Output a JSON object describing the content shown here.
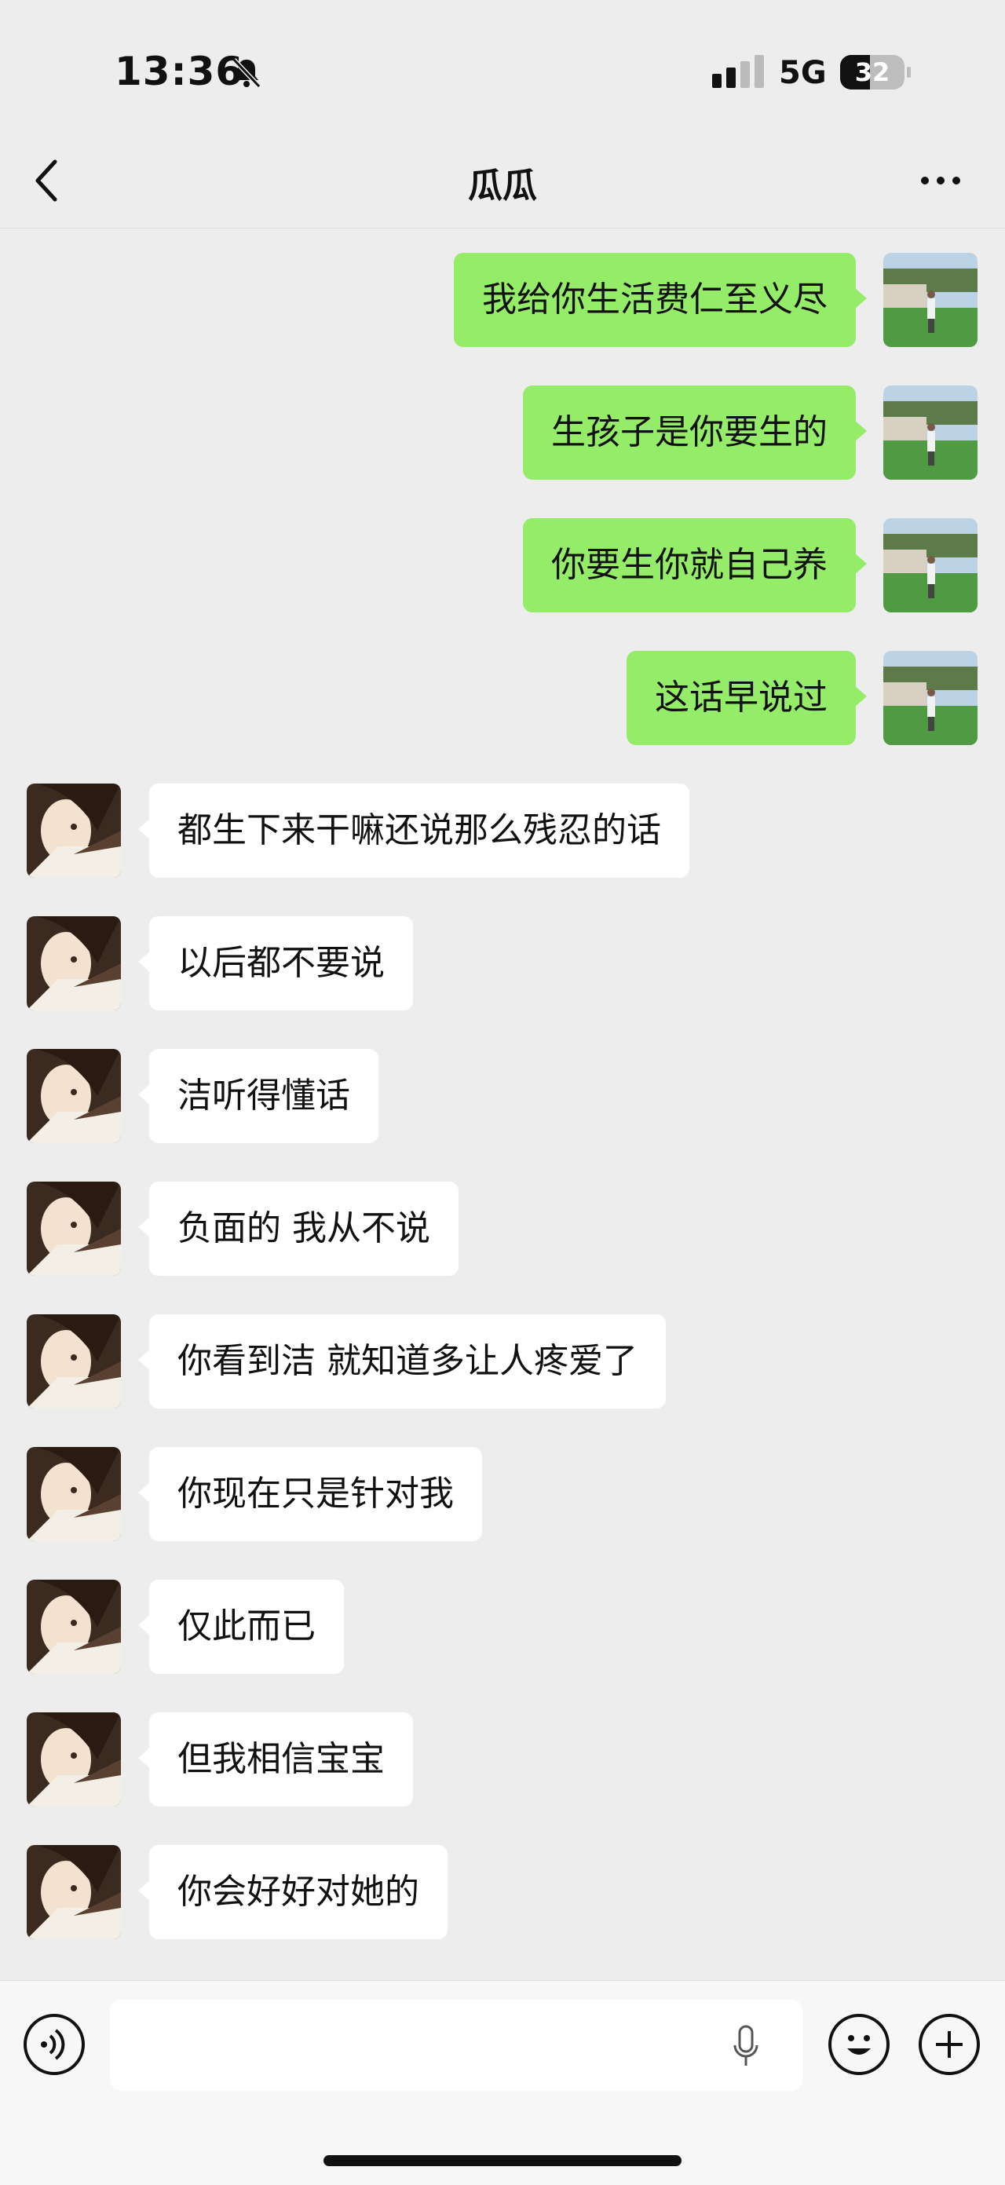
{
  "status_bar": {
    "time": "13:36",
    "network": "5G",
    "battery": "32"
  },
  "header": {
    "title": "瓜瓜"
  },
  "messages": [
    {
      "from": "me",
      "text": "我给你生活费仁至义尽"
    },
    {
      "from": "me",
      "text": "生孩子是你要生的"
    },
    {
      "from": "me",
      "text": "你要生你就自己养"
    },
    {
      "from": "me",
      "text": "这话早说过"
    },
    {
      "from": "other",
      "text": "都生下来干嘛还说那么残忍的话"
    },
    {
      "from": "other",
      "text": "以后都不要说"
    },
    {
      "from": "other",
      "text": "洁听得懂话"
    },
    {
      "from": "other",
      "text": "负面的 我从不说"
    },
    {
      "from": "other",
      "text": "你看到洁 就知道多让人疼爱了"
    },
    {
      "from": "other",
      "text": "你现在只是针对我"
    },
    {
      "from": "other",
      "text": "仅此而已"
    },
    {
      "from": "other",
      "text": "但我相信宝宝"
    },
    {
      "from": "other",
      "text": "你会好好对她的"
    }
  ],
  "icons": {
    "back": "chevron-left-icon",
    "more": "more-icon",
    "voice": "voice-icon",
    "mic": "microphone-icon",
    "emoji": "emoji-icon",
    "plus": "plus-icon"
  },
  "colors": {
    "background": "#ededed",
    "my_bubble": "#95ec69",
    "other_bubble": "#ffffff"
  }
}
